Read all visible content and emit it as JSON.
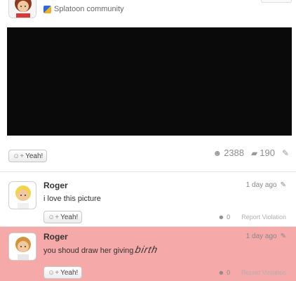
{
  "post": {
    "community": "Splatoon community",
    "icons": {
      "community": "game-community-icon",
      "avatar": "mii-avatar-icon"
    }
  },
  "actions": {
    "yeah_label": "Yeah!",
    "yeah_count": "2388",
    "comment_count": "190",
    "icons": {
      "yeah": "yeah-plus-icon",
      "comments": "speech-bubbles-icon",
      "spoiler": "edit-icon"
    }
  },
  "comments": [
    {
      "author": "Roger",
      "time": "1 day ago",
      "text": "i love this picture",
      "yeah_label": "Yeah!",
      "yeah_count": "0",
      "report_label": "Report Violation",
      "highlighted": false
    },
    {
      "author": "Roger",
      "time": "1 day ago",
      "text_prefix": "you shoud draw her giving ",
      "text_warped": "birth",
      "yeah_label": "Yeah!",
      "yeah_count": "0",
      "report_label": "Report Violation",
      "highlighted": true,
      "highlight_color": "#f6a9a9"
    }
  ]
}
